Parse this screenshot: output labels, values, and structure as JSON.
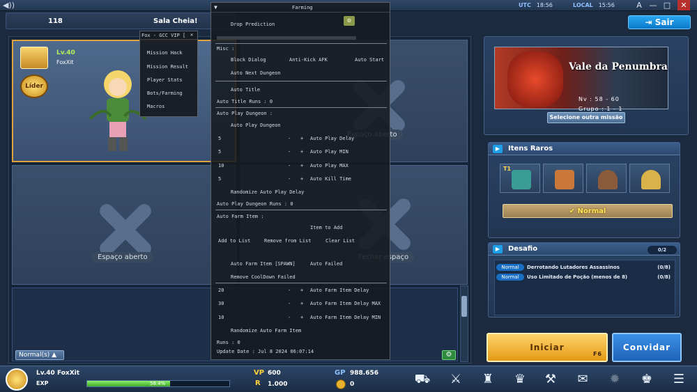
{
  "topbar": {
    "utc_label": "UTC",
    "utc_time": "18:56",
    "local_label": "LOCAL",
    "local_time": "15:56",
    "win_buttons": [
      "A",
      "—",
      "□",
      "✕"
    ]
  },
  "room": {
    "number": "118",
    "name": "Sala Cheia!",
    "exit_label": "Sair"
  },
  "slots": {
    "leader": {
      "level": "Lv.40",
      "name": "FoxXit",
      "badge": "Líder"
    },
    "open_label": "Espaço aberto",
    "closed_label": "Fechar espaço",
    "mode": "Normal(s)"
  },
  "mission": {
    "dungeon_name": "Vale da Penumbra",
    "nv": "Nv : 58 - 60",
    "group": "Grupo : 1 - 1",
    "other_mission_label": "Selecione outra missão"
  },
  "rare_items": {
    "title": "Itens Raros",
    "tier_label": "T1",
    "difficulty": "Normal"
  },
  "desafio": {
    "title": "Desafio",
    "count": "0/2",
    "rows": [
      {
        "tag": "Normal",
        "text": "Derrotando Lutadores Assassinos",
        "count": "(0/8)"
      },
      {
        "tag": "Normal",
        "text": "Uso Limitado de Poção (menos de 8)",
        "count": "(0/8)"
      }
    ]
  },
  "actions": {
    "start_label": "Iniciar",
    "start_key": "F6",
    "invite_label": "Convidar"
  },
  "bottom": {
    "player": "Lv.40 FoxXit",
    "exp_label": "EXP",
    "exp_pct_text": "58.4%",
    "exp_fraction": 0.584,
    "vp_label": "VP",
    "vp_value": "600",
    "r_label": "R",
    "r_value": "1.000",
    "gp_label": "GP",
    "gp_value": "988.656",
    "coin_value": "0"
  },
  "farming": {
    "title": "Farming",
    "drop_prediction": "Drop Prediction",
    "misc_label": "Misc :",
    "block_dialog": "Block Dialog",
    "anti_kick": "Anti-Kick AFK",
    "auto_start": "Auto Start",
    "auto_next": "Auto Next Dungeon",
    "auto_title": "Auto Title",
    "auto_title_runs": "Auto Title Runs : 0",
    "auto_play_header": "Auto Play Dungeon :",
    "auto_play": "Auto Play Dungeon",
    "play_delay": {
      "value": "5",
      "label": "Auto Play Delay"
    },
    "play_min": {
      "value": "5",
      "label": "Auto Play MIN"
    },
    "play_max": {
      "value": "10",
      "label": "Auto Play MAX"
    },
    "kill_time": {
      "value": "5",
      "label": "Auto Kill Time"
    },
    "randomize_play": "Randomize Auto Play Delay",
    "play_runs": "Auto Play Dungeon Runs : 0",
    "farm_header": "Auto Farm Item :",
    "item_to_add": "Item to Add",
    "add_list": "Add to List",
    "remove_list": "Remove from List",
    "clear_list": "Clear List",
    "farm_spawn": "Auto Farm Item [SPAWN]",
    "auto_failed": "Auto Failed",
    "remove_cd": "Remove CoolDown Failed",
    "farm_delay": {
      "value": "20",
      "label": "Auto Farm Item Delay"
    },
    "farm_max": {
      "value": "30",
      "label": "Auto Farm Item Delay MAX"
    },
    "farm_min": {
      "value": "10",
      "label": "Auto Farm Item Delay MIN"
    },
    "randomize_farm": "Randomize Auto Farm Item",
    "runs": "Runs : 0",
    "update_date": "Update Date : Jul  8 2024 06:07:14",
    "minus": "-",
    "plus": "+"
  },
  "fox": {
    "title": "Fox - GCC VIP [",
    "close": "✕",
    "items": [
      "Mission Hack",
      "Mission Result",
      "Player Stats",
      "Bots/Farming",
      "Macros"
    ]
  },
  "colors": {
    "accent_blue": "#1ea0e8",
    "start_gold": "#e49a14",
    "leader_border": "#e2a23c",
    "exp_green": "#3fa82a"
  }
}
